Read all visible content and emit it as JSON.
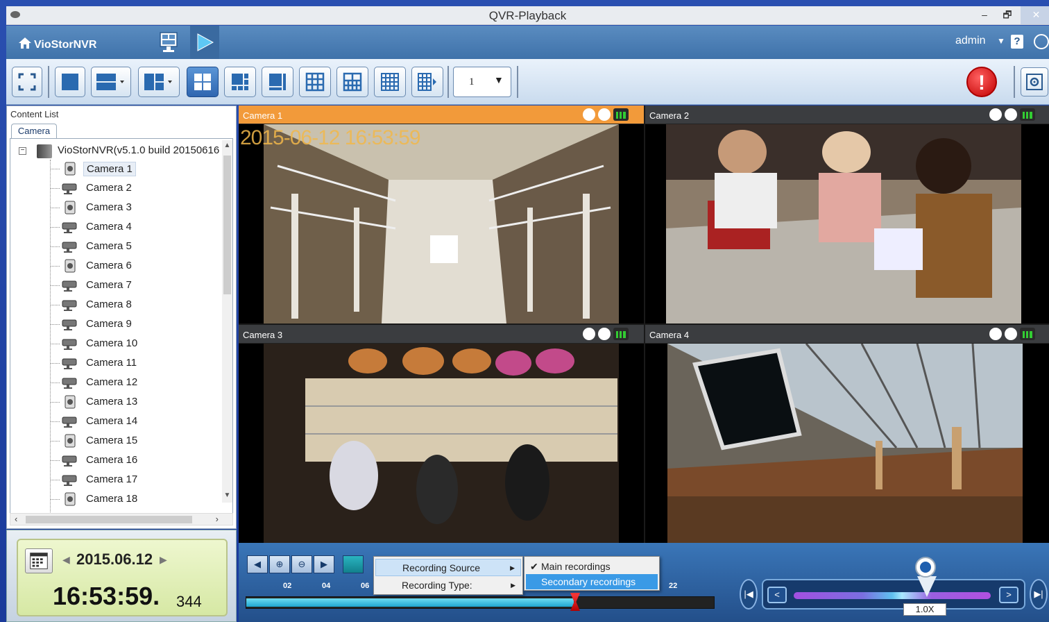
{
  "window": {
    "title": "QVR-Playback",
    "min": "–",
    "restore": "🗗",
    "close": "✕"
  },
  "appbar": {
    "brand": "VioStorNVR",
    "user": "admin",
    "help": "?"
  },
  "toolbar": {
    "page_value": "1",
    "alert": "!"
  },
  "content_list": {
    "title": "Content List",
    "tab": "Camera",
    "root": "VioStorNVR(v5.1.0 build 20150616",
    "cameras": [
      {
        "label": "Camera 1",
        "kind": "dome"
      },
      {
        "label": "Camera 2",
        "kind": "bullet"
      },
      {
        "label": "Camera 3",
        "kind": "dome"
      },
      {
        "label": "Camera 4",
        "kind": "bullet"
      },
      {
        "label": "Camera 5",
        "kind": "bullet"
      },
      {
        "label": "Camera 6",
        "kind": "dome"
      },
      {
        "label": "Camera 7",
        "kind": "bullet"
      },
      {
        "label": "Camera 8",
        "kind": "bullet"
      },
      {
        "label": "Camera 9",
        "kind": "bullet"
      },
      {
        "label": "Camera 10",
        "kind": "bullet"
      },
      {
        "label": "Camera 11",
        "kind": "bullet"
      },
      {
        "label": "Camera 12",
        "kind": "bullet"
      },
      {
        "label": "Camera 13",
        "kind": "dome"
      },
      {
        "label": "Camera 14",
        "kind": "bullet"
      },
      {
        "label": "Camera 15",
        "kind": "dome"
      },
      {
        "label": "Camera 16",
        "kind": "bullet"
      },
      {
        "label": "Camera 17",
        "kind": "bullet"
      },
      {
        "label": "Camera 18",
        "kind": "dome"
      }
    ],
    "selected_index": 0
  },
  "datetime": {
    "date": "2015.06.12",
    "time": "16:53:59.",
    "ms": "344"
  },
  "views": [
    {
      "title": "Camera 1",
      "active": true,
      "osd": "2015-06-12 16:53:59"
    },
    {
      "title": "Camera 2",
      "active": false
    },
    {
      "title": "Camera 3",
      "active": false
    },
    {
      "title": "Camera 4",
      "active": false
    }
  ],
  "timeline": {
    "hours": [
      "02",
      "04",
      "06",
      "22"
    ],
    "fill_fraction": 0.7
  },
  "context_menu": {
    "items": [
      {
        "label": "Recording Source",
        "highlighted": true
      },
      {
        "label": "Recording Type:",
        "highlighted": false
      }
    ],
    "submenu": [
      {
        "label": "Main recordings",
        "checked": true,
        "selected": false
      },
      {
        "label": "Secondary recordings",
        "checked": false,
        "selected": true
      }
    ]
  },
  "speed": {
    "label": "1.0X"
  },
  "colors": {
    "active_cell": "#f29a3a",
    "accent": "#2f66b0",
    "alert": "#c00000"
  }
}
